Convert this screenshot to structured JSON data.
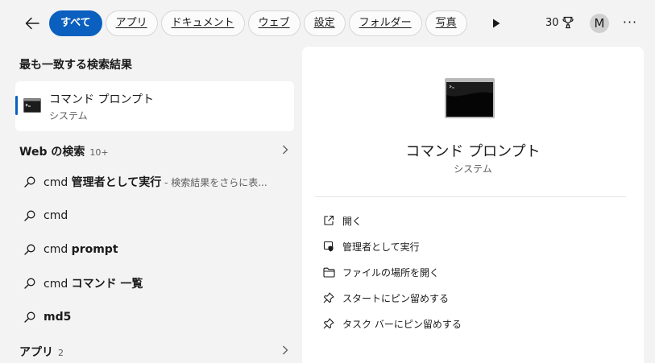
{
  "filters": [
    "すべて",
    "アプリ",
    "ドキュメント",
    "ウェブ",
    "設定",
    "フォルダー",
    "写真"
  ],
  "points": "30",
  "avatar_initial": "M",
  "more_label": "···",
  "best_match": {
    "heading": "最も一致する検索結果",
    "title": "コマンド プロンプト",
    "subtitle": "システム"
  },
  "web": {
    "heading": "Web の検索",
    "count": "10+",
    "results": [
      {
        "prefix": "cmd ",
        "bold": "管理者として実行",
        "suffix": " - 検索結果をさらに表..."
      },
      {
        "prefix": "cmd",
        "bold": "",
        "suffix": ""
      },
      {
        "prefix": "cmd ",
        "bold": "prompt",
        "suffix": ""
      },
      {
        "prefix": "cmd ",
        "bold": "コマンド 一覧",
        "suffix": ""
      },
      {
        "prefix": "",
        "bold": "md5",
        "suffix": ""
      }
    ]
  },
  "apps": {
    "heading": "アプリ",
    "count": "2"
  },
  "preview": {
    "title": "コマンド プロンプト",
    "subtitle": "システム",
    "actions": [
      {
        "icon": "open-external-icon",
        "label": "開く"
      },
      {
        "icon": "shield-icon",
        "label": "管理者として実行"
      },
      {
        "icon": "folder-icon",
        "label": "ファイルの場所を開く"
      },
      {
        "icon": "pin-icon",
        "label": "スタートにピン留めする"
      },
      {
        "icon": "pin-icon",
        "label": "タスク バーにピン留めする"
      }
    ]
  },
  "colors": {
    "accent": "#0a5fbf",
    "background": "#f3f3f3",
    "panel": "#ffffff"
  }
}
